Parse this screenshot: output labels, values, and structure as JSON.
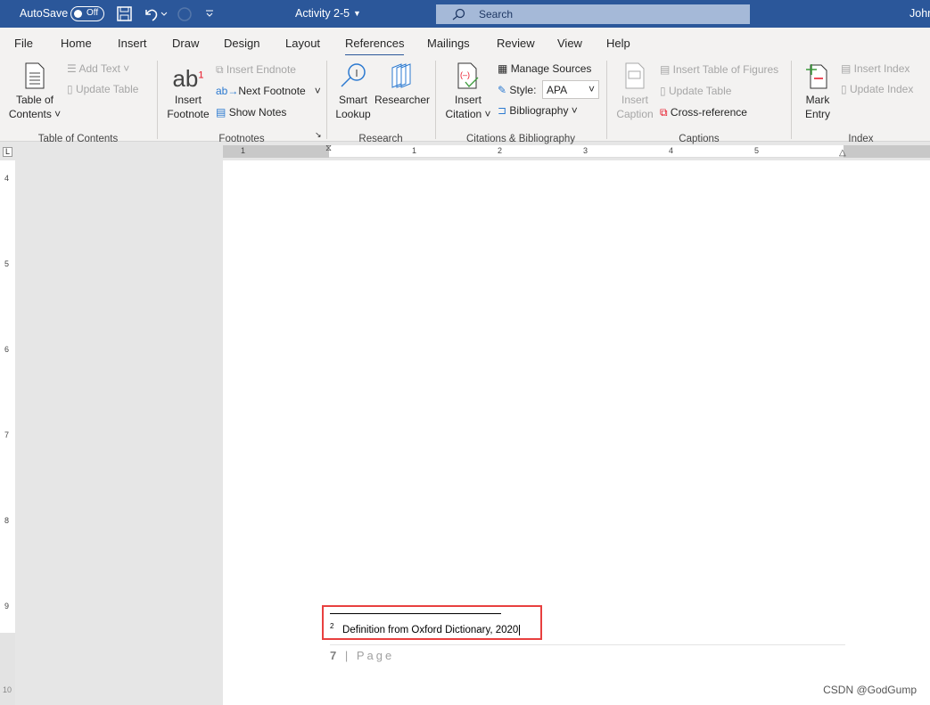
{
  "titlebar": {
    "autosave": "AutoSave",
    "toggle": "Off",
    "doc_title": "Activity 2-5",
    "search_placeholder": "Search",
    "user": "John"
  },
  "tabs": [
    "File",
    "Home",
    "Insert",
    "Draw",
    "Design",
    "Layout",
    "References",
    "Mailings",
    "Review",
    "View",
    "Help"
  ],
  "active_tab": "References",
  "ribbon": {
    "toc": {
      "toc_button": [
        "Table of",
        "Contents"
      ],
      "add_text": "Add Text",
      "update_table": "Update Table",
      "group": "Table of Contents"
    },
    "footnotes": {
      "insert_footnote": [
        "Insert",
        "Footnote"
      ],
      "insert_endnote": "Insert Endnote",
      "next_footnote": "Next Footnote",
      "show_notes": "Show Notes",
      "group": "Footnotes"
    },
    "research": {
      "smart_lookup": [
        "Smart",
        "Lookup"
      ],
      "researcher": "Researcher",
      "group": "Research"
    },
    "citations": {
      "insert_citation": [
        "Insert",
        "Citation"
      ],
      "manage_sources": "Manage Sources",
      "style_label": "Style:",
      "style_value": "APA",
      "bibliography": "Bibliography",
      "group": "Citations & Bibliography"
    },
    "captions": {
      "insert_caption": [
        "Insert",
        "Caption"
      ],
      "insert_tof": "Insert Table of Figures",
      "update_table": "Update Table",
      "cross_reference": "Cross-reference",
      "group": "Captions"
    },
    "index": {
      "mark_entry": [
        "Mark",
        "Entry"
      ],
      "insert_index": "Insert Index",
      "update_index": "Update Index",
      "group": "Index"
    }
  },
  "ruler": {
    "h_ticks": [
      "1",
      "1",
      "2",
      "3",
      "4",
      "5"
    ],
    "v_ticks": [
      "4",
      "5",
      "6",
      "7",
      "8",
      "9",
      "10"
    ]
  },
  "document": {
    "footnote_number": "2",
    "footnote_text": "Definition from Oxford Dictionary, 2020",
    "page_number": "7",
    "page_label": "| Page"
  },
  "watermark": "CSDN @GodGump",
  "colors": {
    "titlebar": "#2b579a",
    "highlight_box": "#e8403f"
  }
}
